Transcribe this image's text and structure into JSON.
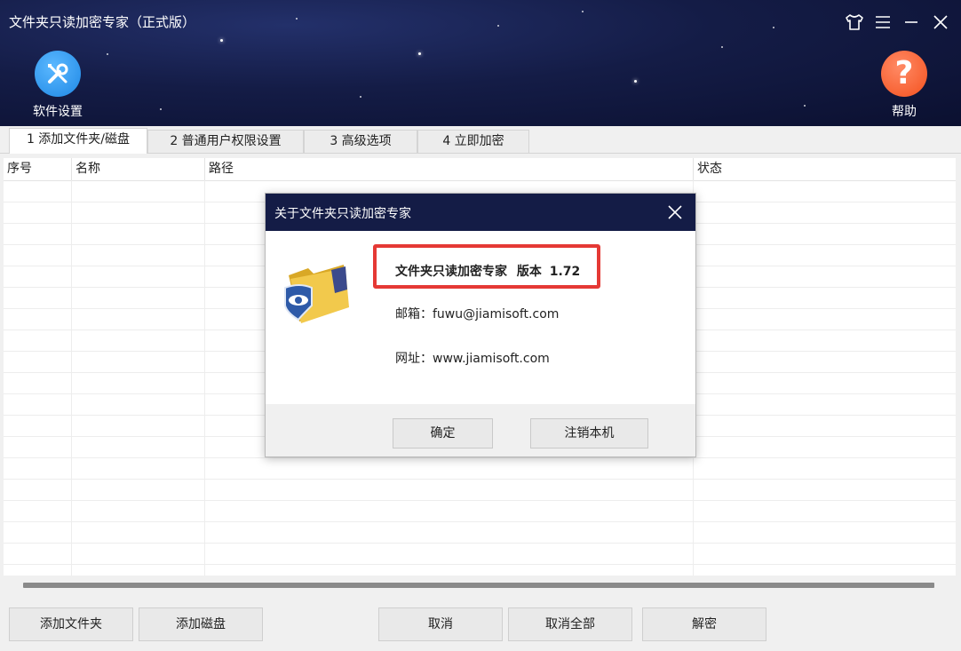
{
  "window": {
    "title": "文件夹只读加密专家（正式版）"
  },
  "toolbar": {
    "settings_label": "软件设置",
    "help_label": "帮助"
  },
  "tabs": [
    {
      "label": "1 添加文件夹/磁盘"
    },
    {
      "label": "2 普通用户权限设置"
    },
    {
      "label": "3 高级选项"
    },
    {
      "label": "4 立即加密"
    }
  ],
  "table": {
    "columns": [
      {
        "label": "序号"
      },
      {
        "label": "名称"
      },
      {
        "label": "路径"
      },
      {
        "label": "状态"
      }
    ]
  },
  "buttons": {
    "add_folder": "添加文件夹",
    "add_disk": "添加磁盘",
    "cancel": "取消",
    "cancel_all": "取消全部",
    "decrypt": "解密"
  },
  "dialog": {
    "title": "关于文件夹只读加密专家",
    "product_name": "文件夹只读加密专家",
    "version_prefix": "版本",
    "version": "1.72",
    "email_label": "邮箱：",
    "email": "fuwu@jiamisoft.com",
    "website_label": "网址：",
    "website": "www.jiamisoft.com",
    "ok_label": "确定",
    "unregister_label": "注销本机"
  },
  "colors": {
    "header_bg": "#141c46",
    "settings_icon": "#2196f3",
    "help_icon": "#f4623a",
    "highlight": "#e53935"
  }
}
